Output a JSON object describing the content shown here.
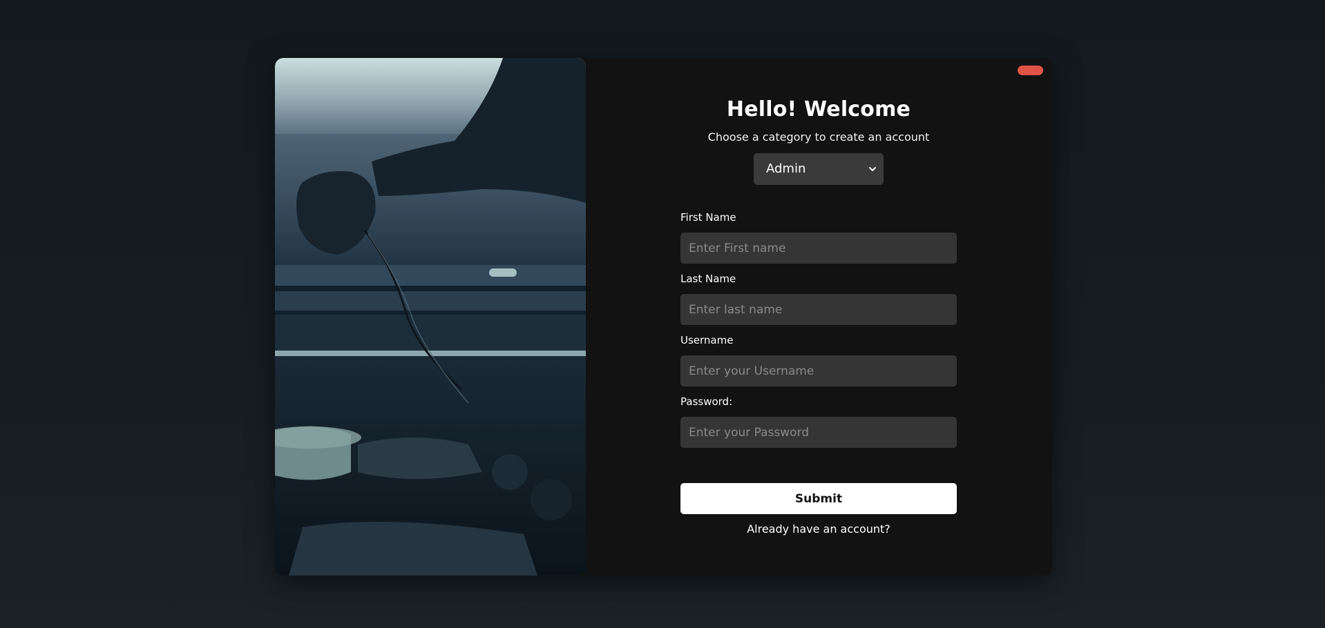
{
  "colors": {
    "page_background": "#141a1e",
    "card_background": "#121212",
    "input_background": "#353535",
    "select_background": "#3a3a3a",
    "close_accent": "#e05447",
    "submit_background": "#ffffff"
  },
  "hero_image": {
    "icon": "mechanic-engine-photo"
  },
  "header": {
    "title": "Hello! Welcome",
    "subtitle": "Choose a category to create an account"
  },
  "category_select": {
    "selected": "Admin",
    "icon": "chevron-down-icon"
  },
  "form": {
    "first_name": {
      "label": "First Name",
      "placeholder": "Enter First name",
      "value": ""
    },
    "last_name": {
      "label": "Last Name",
      "placeholder": "Enter last name",
      "value": ""
    },
    "username": {
      "label": "Username",
      "placeholder": "Enter your Username",
      "value": ""
    },
    "password": {
      "label": "Password:",
      "placeholder": "Enter your Password",
      "value": ""
    }
  },
  "actions": {
    "submit_label": "Submit",
    "login_link": "Already have an account?"
  }
}
